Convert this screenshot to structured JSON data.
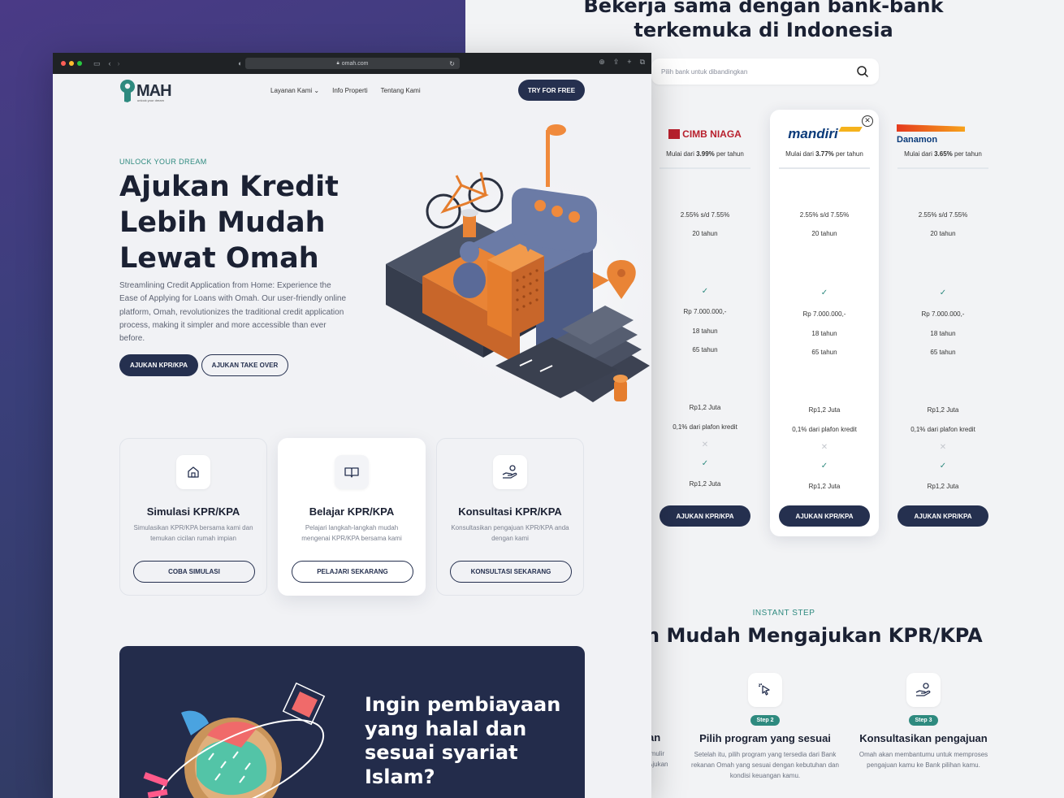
{
  "comparison": {
    "heading": "Bekerja sama dengan bank-bank terkemuka di Indonesia",
    "search_placeholder": "Pilih bank untuk dibandingkan",
    "banks": [
      {
        "name": "CIMB NIAGA",
        "rate_prefix": "Mulai dari",
        "rate": "3.99%",
        "rate_suffix": "per tahun",
        "interest_range": "2.55% s/d 7.55%",
        "tenor": "20 tahun",
        "min_income": "Rp 7.000.000,-",
        "min_age": "18 tahun",
        "max_age": "65 tahun",
        "fee": "Rp1,2 Juta",
        "provision": "0,1% dari plafon kredit",
        "admin": "Rp1,2 Juta",
        "button": "AJUKAN KPR/KPA",
        "color": "#b8202d"
      },
      {
        "name": "mandiri",
        "rate_prefix": "Mulai dari",
        "rate": "3.77%",
        "rate_suffix": "per tahun",
        "interest_range": "2.55% s/d 7.55%",
        "tenor": "20 tahun",
        "min_income": "Rp 7.000.000,-",
        "min_age": "18 tahun",
        "max_age": "65 tahun",
        "fee": "Rp1,2 Juta",
        "provision": "0,1% dari plafon kredit",
        "admin": "Rp1,2 Juta",
        "button": "AJUKAN KPR/KPA",
        "color": "#0b3b7a"
      },
      {
        "name": "Danamon",
        "rate_prefix": "Mulai dari",
        "rate": "3.65%",
        "rate_suffix": "per tahun",
        "interest_range": "2.55% s/d 7.55%",
        "tenor": "20 tahun",
        "min_income": "Rp 7.000.000,-",
        "min_age": "18 tahun",
        "max_age": "65 tahun",
        "fee": "Rp1,2 Juta",
        "provision": "0,1% dari plafon kredit",
        "admin": "Rp1,2 Juta",
        "button": "AJUKAN KPR/KPA",
        "color": "#0b3b7a"
      }
    ]
  },
  "steps": {
    "eyebrow": "INSTANT STEP",
    "heading": "n Mudah Mengajukan KPR/KPA",
    "partial_title": "an",
    "partial_desc": "rmulir\nAjukan",
    "items": [
      {
        "badge": "Step 2",
        "title": "Pilih program yang sesuai",
        "desc": "Setelah itu, pilih program yang tersedia dari Bank rekanan Omah yang sesuai dengan kebutuhan dan kondisi keuangan kamu."
      },
      {
        "badge": "Step 3",
        "title": "Konsultasikan pengajuan",
        "desc": "Omah akan membantumu untuk memproses pengajuan kamu ke Bank pilihan kamu."
      }
    ]
  },
  "browser": {
    "url": "omah.com",
    "logo_text": "MAH",
    "logo_tagline": "unlock your dream",
    "nav": [
      "Layanan Kami",
      "Info Properti",
      "Tentang Kami"
    ],
    "nav_cta": "TRY FOR FREE",
    "hero": {
      "eyebrow": "UNLOCK YOUR DREAM",
      "title_lines": [
        "Ajukan Kredit",
        "Lebih Mudah",
        "Lewat Omah"
      ],
      "description": "Streamlining Credit Application from Home: Experience the Ease of Applying for Loans with Omah. Our user-friendly online platform, Omah, revolutionizes the traditional credit application process, making it simpler and more accessible than ever before.",
      "primary_button": "AJUKAN KPR/KPA",
      "secondary_button": "AJUKAN TAKE OVER"
    },
    "cards": [
      {
        "title": "Simulasi KPR/KPA",
        "desc": "Simulasikan KPR/KPA bersama kami dan temukan cicilan rumah impian",
        "button": "COBA SIMULASI",
        "icon": "house-icon"
      },
      {
        "title": "Belajar KPR/KPA",
        "desc": "Pelajari langkah-langkah mudah mengenai KPR/KPA bersama kami",
        "button": "PELAJARI SEKARANG",
        "icon": "book-icon"
      },
      {
        "title": "Konsultasi KPR/KPA",
        "desc": "Konsultasikan pengajuan KPR/KPA anda dengan kami",
        "button": "KONSULTASI SEKARANG",
        "icon": "hand-coin-icon"
      }
    ],
    "banner_title": "Ingin pembiayaan yang halal dan sesuai syariat Islam?"
  },
  "colors": {
    "primary": "#25304f",
    "accent": "#2e8a7f",
    "orange": "#f08a3c"
  }
}
